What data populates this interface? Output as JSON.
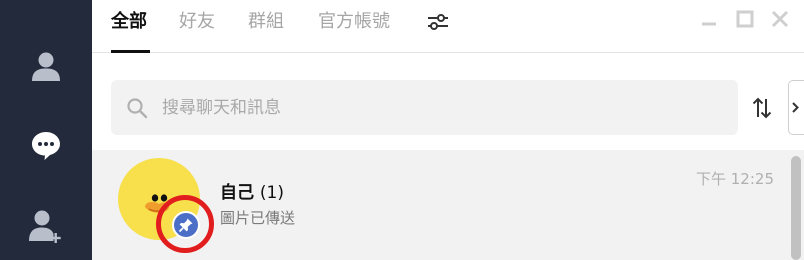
{
  "tabs": {
    "all": "全部",
    "friends": "好友",
    "groups": "群組",
    "official": "官方帳號"
  },
  "search": {
    "placeholder": "搜尋聊天和訊息"
  },
  "chats": [
    {
      "name": "自己",
      "unread": "(1)",
      "preview": "圖片已傳送",
      "time": "下午 12:25",
      "pinned": true
    }
  ],
  "icons": {
    "rail": [
      "person-icon",
      "chat-bubble-icon",
      "add-friend-icon"
    ],
    "tabs_filter": "sliders-icon",
    "window": [
      "minimize-icon",
      "maximize-icon",
      "close-icon"
    ],
    "search": "search-icon",
    "sort": "sort-arrows-icon",
    "collapse": "chevron-right-icon",
    "badge": "pin-icon"
  },
  "colors": {
    "rail_bg": "#222a3b",
    "active_tab": "#111111",
    "inactive_tab": "#a6a6a6",
    "selected_row": "#f2f2f2",
    "pin_badge": "#4b6fc6",
    "highlight_ring": "#e21d1d"
  }
}
